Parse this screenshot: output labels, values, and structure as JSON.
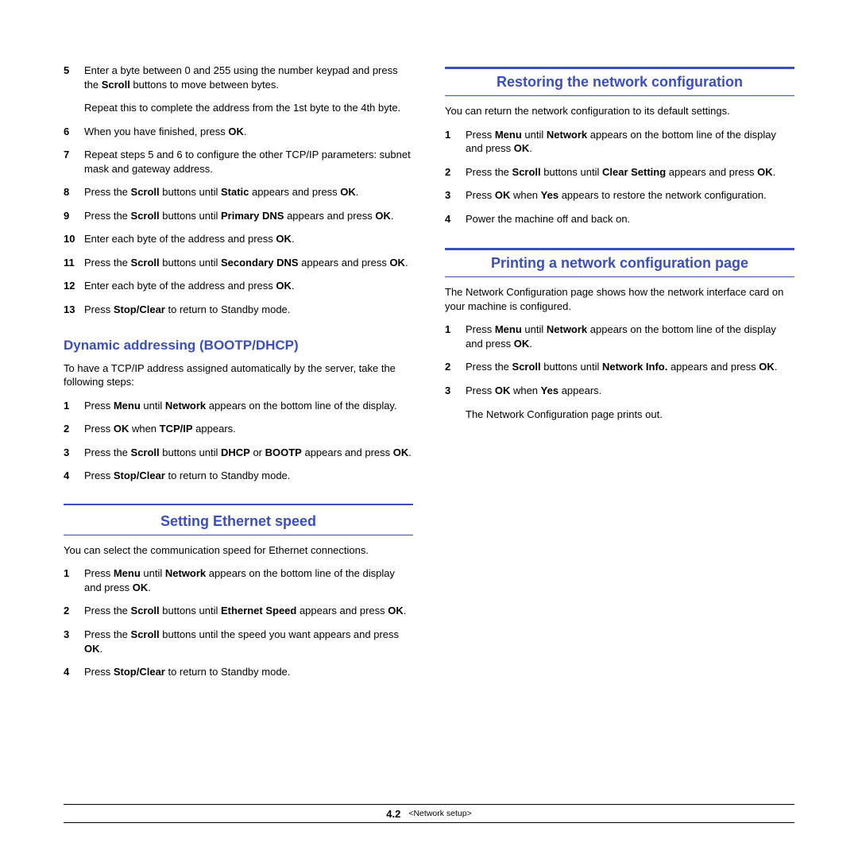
{
  "left": {
    "topSteps": [
      {
        "n": "5",
        "html": "Enter a byte between 0 and 255 using the number keypad and press the <b>Scroll</b> buttons to move between bytes."
      },
      {
        "para": "Repeat this to complete the address from the 1st byte to the 4th byte."
      },
      {
        "n": "6",
        "html": "When you have finished, press <b>OK</b>."
      },
      {
        "n": "7",
        "html": "Repeat steps 5 and 6 to configure the other TCP/IP parameters: subnet mask and gateway address."
      },
      {
        "n": "8",
        "html": "Press the <b>Scroll</b> buttons until <b>Static</b> appears and press <b>OK</b>."
      },
      {
        "n": "9",
        "html": "Press the <b>Scroll</b> buttons until <b>Primary DNS</b> appears and press <b>OK</b>."
      },
      {
        "n": "10",
        "html": "Enter each byte of the address and press <b>OK</b>."
      },
      {
        "n": "11",
        "html": "Press the <b>Scroll</b> buttons until <b>Secondary DNS</b> appears and press <b>OK</b>."
      },
      {
        "n": "12",
        "html": "Enter each byte of the address and press <b>OK</b>."
      },
      {
        "n": "13",
        "html": "Press <b>Stop/Clear</b> to return to Standby mode."
      }
    ],
    "sub1": {
      "title": "Dynamic addressing (BOOTP/DHCP)",
      "intro": "To have a TCP/IP address assigned automatically by the server, take the following steps:",
      "steps": [
        {
          "n": "1",
          "html": "Press <b>Menu</b> until <b>Network</b> appears on the bottom line of the display."
        },
        {
          "n": "2",
          "html": "Press <b>OK</b> when <b>TCP/IP</b> appears."
        },
        {
          "n": "3",
          "html": "Press the <b>Scroll</b> buttons until <b>DHCP</b> or <b>BOOTP</b> appears and press <b>OK</b>."
        },
        {
          "n": "4",
          "html": "Press <b>Stop/Clear</b> to return to Standby mode."
        }
      ]
    },
    "sec2": {
      "title": "Setting Ethernet speed",
      "intro": "You can select the communication speed for Ethernet connections.",
      "steps": [
        {
          "n": "1",
          "html": "Press <b>Menu</b> until <b>Network</b> appears on the bottom line of the display and press <b>OK</b>."
        },
        {
          "n": "2",
          "html": "Press the <b>Scroll</b> buttons until <b>Ethernet Speed</b> appears and press <b>OK</b>."
        },
        {
          "n": "3",
          "html": "Press the <b>Scroll</b> buttons until the speed you want appears and press <b>OK</b>."
        },
        {
          "n": "4",
          "html": "Press <b>Stop/Clear</b> to return to Standby mode."
        }
      ]
    }
  },
  "right": {
    "sec1": {
      "title": "Restoring the network configuration",
      "intro": "You can return the network configuration to its default settings.",
      "steps": [
        {
          "n": "1",
          "html": "Press <b>Menu</b> until <b>Network</b> appears on the bottom line of the display and press <b>OK</b>."
        },
        {
          "n": "2",
          "html": "Press the <b>Scroll</b> buttons until <b>Clear Setting</b> appears and press <b>OK</b>."
        },
        {
          "n": "3",
          "html": "Press <b>OK</b> when <b>Yes</b> appears to restore the network configuration."
        },
        {
          "n": "4",
          "html": "Power the machine off and back on."
        }
      ]
    },
    "sec2": {
      "title": "Printing a network configuration page",
      "intro": "The Network Configuration page shows how the network interface card on your machine is configured.",
      "steps": [
        {
          "n": "1",
          "html": "Press <b>Menu</b> until <b>Network</b> appears on the bottom line of the display and press <b>OK</b>."
        },
        {
          "n": "2",
          "html": "Press the <b>Scroll</b> buttons until <b>Network Info.</b> appears and press <b>OK</b>."
        },
        {
          "n": "3",
          "html": "Press <b>OK</b> when <b>Yes</b> appears."
        },
        {
          "para": "The Network Configuration page prints out."
        }
      ]
    }
  },
  "footer": {
    "page": "4.2",
    "label": "<Network setup>"
  }
}
